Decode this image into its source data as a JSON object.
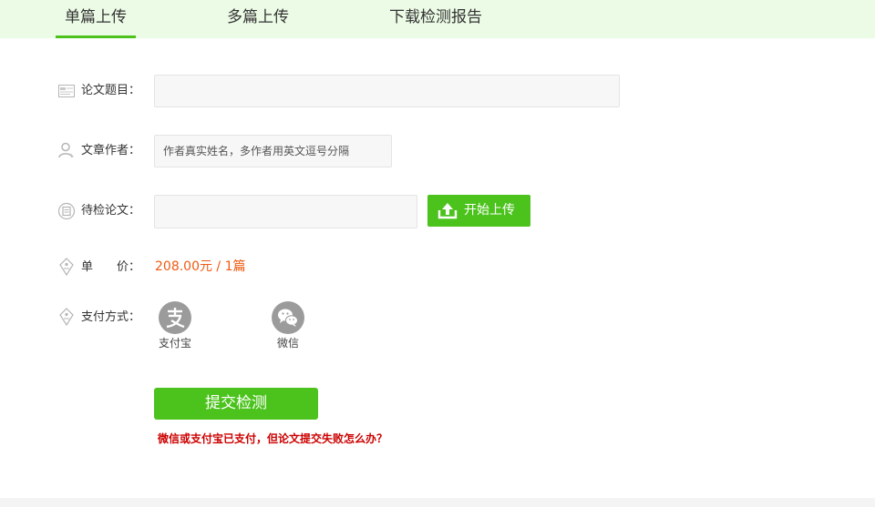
{
  "tabs": [
    {
      "label": "单篇上传",
      "active": true
    },
    {
      "label": "多篇上传",
      "active": false
    },
    {
      "label": "下载检测报告",
      "active": false
    }
  ],
  "form": {
    "title_label": "论文题目：",
    "title_value": "",
    "author_label": "文章作者：",
    "author_placeholder": "作者真实姓名，多作者用英文逗号分隔",
    "file_label": "待检论文：",
    "file_value": "",
    "upload_button": "开始上传",
    "price_label": "单　　价：",
    "price_value": "208.00元 / 1篇",
    "payment_label": "支付方式：",
    "payment_options": [
      {
        "label": "支付宝",
        "icon": "alipay-icon"
      },
      {
        "label": "微信",
        "icon": "wechat-icon"
      }
    ],
    "submit_button": "提交检测",
    "help_link": "微信或支付宝已支付，但论文提交失败怎么办？"
  },
  "colors": {
    "accent": "#4cc31d",
    "tab_bar_bg": "#ecfbe6",
    "price": "#f05a14",
    "help_link": "#cc0000",
    "pay_icon": "#9b9b9b"
  }
}
